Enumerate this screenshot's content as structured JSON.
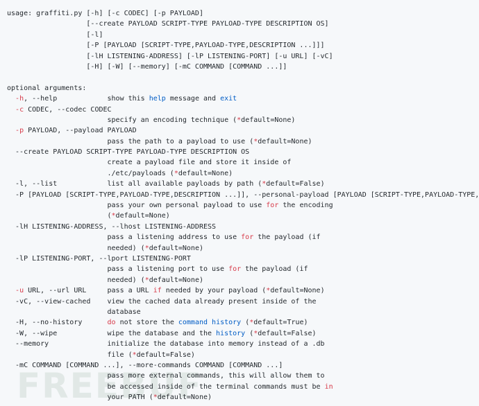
{
  "colors": {
    "background": "#f6f8fa",
    "text": "#24292e",
    "keyword_red": "#d73a49",
    "builtin_blue": "#005cc5"
  },
  "watermark": "FREEBUF",
  "lines": [
    [
      "usage: graffiti.py [-h] [-c CODEC] [-p PAYLOAD]"
    ],
    [
      "                   [--create PAYLOAD SCRIPT-TYPE PAYLOAD-TYPE DESCRIPTION OS]"
    ],
    [
      "                   [-l]"
    ],
    [
      "                   [-P [PAYLOAD [SCRIPT-TYPE,PAYLOAD-TYPE,DESCRIPTION ...]]]"
    ],
    [
      "                   [-lH LISTENING-ADDRESS] [-lP LISTENING-PORT] [-u URL] [-vC]"
    ],
    [
      "                   [-H] [-W] [--memory] [-mC COMMAND [COMMAND ...]]"
    ],
    [
      ""
    ],
    [
      "optional arguments:"
    ],
    [
      "  ",
      {
        "r": "-h"
      },
      ", --help            show this ",
      {
        "b": "help"
      },
      " message and ",
      {
        "b": "exit"
      }
    ],
    [
      "  ",
      {
        "r": "-c"
      },
      " CODEC, --codec CODEC"
    ],
    [
      "                        specify an encoding technique (",
      {
        "r": "*"
      },
      "default=None)"
    ],
    [
      "  ",
      {
        "r": "-p"
      },
      " PAYLOAD, --payload PAYLOAD"
    ],
    [
      "                        pass the path to a payload to use (",
      {
        "r": "*"
      },
      "default=None)"
    ],
    [
      "  --create PAYLOAD SCRIPT-TYPE PAYLOAD-TYPE DESCRIPTION OS"
    ],
    [
      "                        create a payload file and store it inside of"
    ],
    [
      "                        ./etc/payloads (",
      {
        "r": "*"
      },
      "default=None)"
    ],
    [
      "  -l, --list            list all available payloads by path (",
      {
        "r": "*"
      },
      "default=False)"
    ],
    [
      "  -P [PAYLOAD [SCRIPT-TYPE,PAYLOAD-TYPE,DESCRIPTION ...]], --personal-payload [PAYLOAD [SCRIPT-TYPE,PAYLOAD-TYPE,"
    ],
    [
      "                        pass your own personal payload to use ",
      {
        "r": "for"
      },
      " the encoding"
    ],
    [
      "                        (",
      {
        "r": "*"
      },
      "default=None)"
    ],
    [
      "  -lH LISTENING-ADDRESS, --lhost LISTENING-ADDRESS"
    ],
    [
      "                        pass a listening address to use ",
      {
        "r": "for"
      },
      " the payload (if"
    ],
    [
      "                        needed) (",
      {
        "r": "*"
      },
      "default=None)"
    ],
    [
      "  -lP LISTENING-PORT, --lport LISTENING-PORT"
    ],
    [
      "                        pass a listening port to use ",
      {
        "r": "for"
      },
      " the payload (if"
    ],
    [
      "                        needed) (",
      {
        "r": "*"
      },
      "default=None)"
    ],
    [
      "  ",
      {
        "r": "-u"
      },
      " URL, --url URL     pass a URL ",
      {
        "r": "if"
      },
      " needed by your payload (",
      {
        "r": "*"
      },
      "default=None)"
    ],
    [
      "  -vC, --view-cached    view the cached data already present inside of the"
    ],
    [
      "                        database"
    ],
    [
      "  -H, --no-history      ",
      {
        "r": "do"
      },
      " not store the ",
      {
        "b": "command"
      },
      " ",
      {
        "b": "history"
      },
      " (",
      {
        "r": "*"
      },
      "default=True)"
    ],
    [
      "  -W, --wipe            wipe the database and the ",
      {
        "b": "history"
      },
      " (",
      {
        "r": "*"
      },
      "default=False)"
    ],
    [
      "  --memory              initialize the database into memory instead of a .db"
    ],
    [
      "                        file (",
      {
        "r": "*"
      },
      "default=False)"
    ],
    [
      "  -mC COMMAND [COMMAND ...], --more-commands COMMAND [COMMAND ...]"
    ],
    [
      "                        pass more external commands, this will allow them to"
    ],
    [
      "                        be accessed inside of the terminal commands must be ",
      {
        "r": "in"
      }
    ],
    [
      "                        your PATH (",
      {
        "r": "*"
      },
      "default=None)"
    ]
  ]
}
